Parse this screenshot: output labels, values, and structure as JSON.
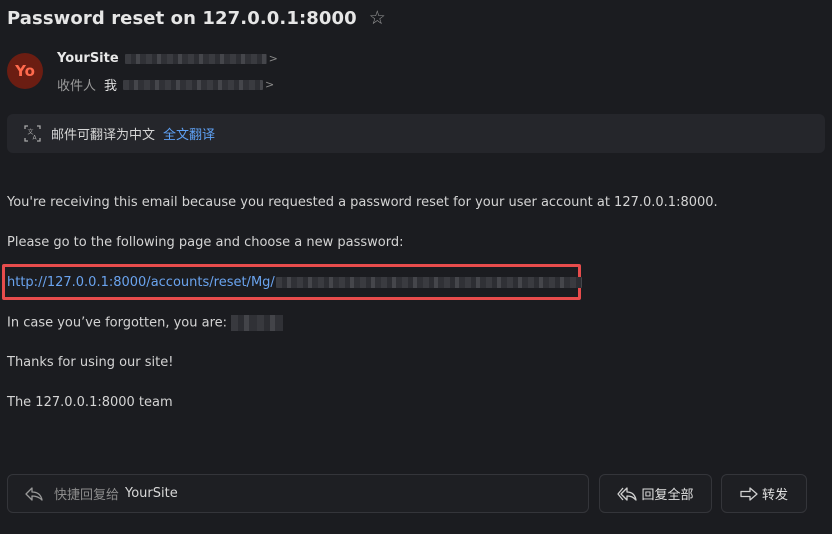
{
  "email": {
    "subject": "Password reset on 127.0.0.1:8000",
    "star_icon": "star-outline-icon",
    "sender": {
      "avatar_initials": "Yo",
      "name": "YourSite"
    },
    "recipient": {
      "label": "收件人",
      "name": "我"
    }
  },
  "translate_bar": {
    "text": "邮件可翻译为中文",
    "link": "全文翻译"
  },
  "body": {
    "line1": "You're receiving this email because you requested a password reset for your user account at 127.0.0.1:8000.",
    "line2": "Please go to the following page and choose a new password:",
    "reset_link_prefix": "http://127.0.0.1:8000/accounts/reset/Mg/",
    "forgot_label": "In case you’ve forgotten, you are:",
    "thanks": "Thanks for using our site!",
    "signature": "The 127.0.0.1:8000 team"
  },
  "footer": {
    "quick_reply_prefix": "快捷回复给",
    "quick_reply_name": "YourSite",
    "reply_all": "回复全部",
    "forward": "转发"
  },
  "colors": {
    "background": "#1b1c20",
    "link": "#6aa3ee",
    "highlight_box": "#e74c4c",
    "avatar_bg": "#6b1d12",
    "avatar_fg": "#ff6a4d"
  }
}
